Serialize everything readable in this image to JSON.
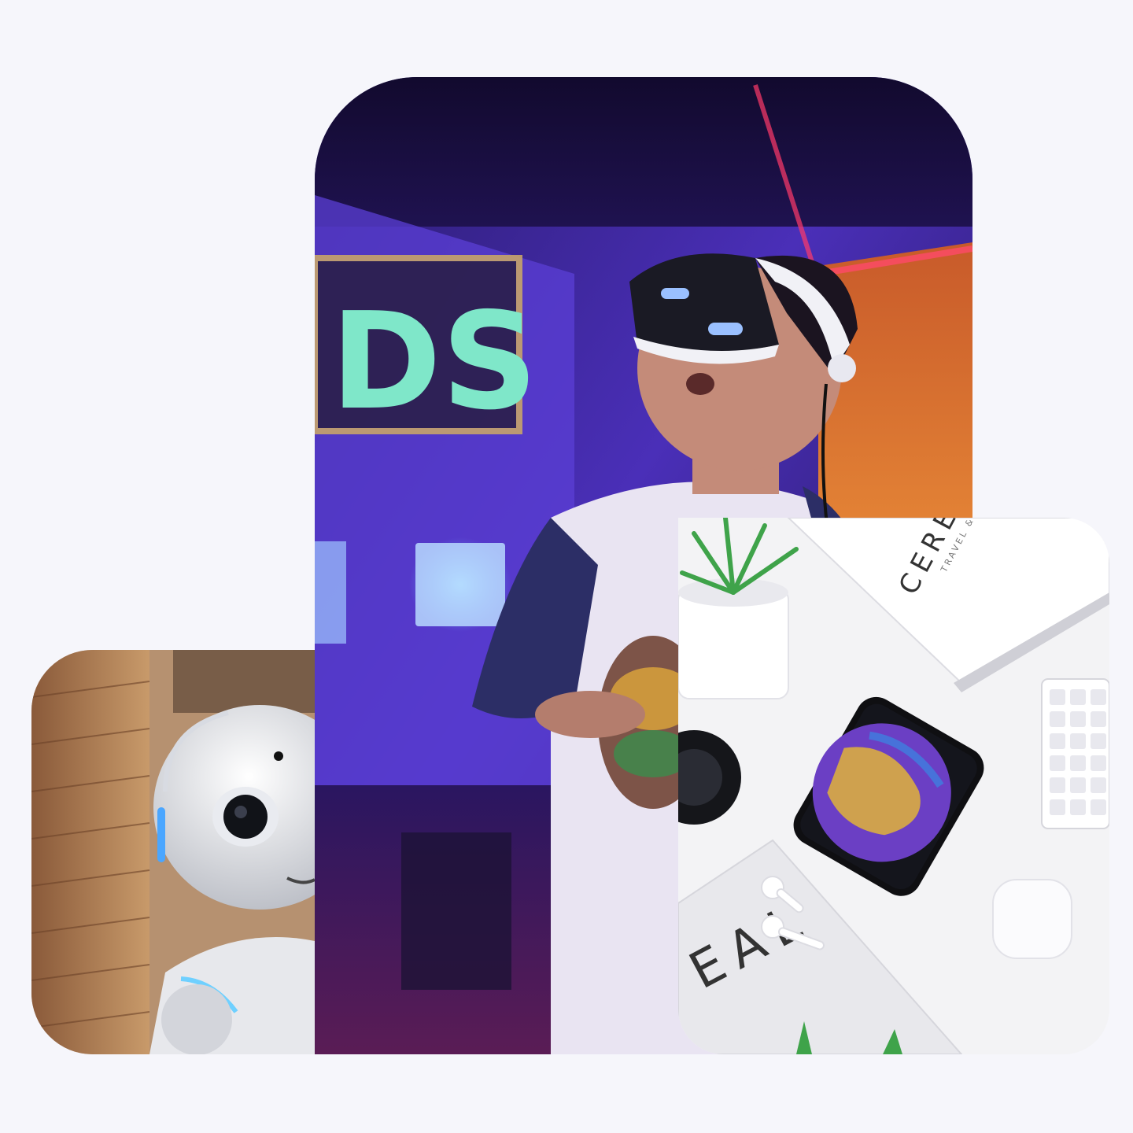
{
  "gallery": {
    "images": [
      {
        "id": "vr",
        "icon": "vr-headset-person-photo"
      },
      {
        "id": "robot",
        "icon": "humanoid-robot-photo"
      },
      {
        "id": "desk",
        "icon": "desk-flatlay-photo"
      }
    ],
    "magazine_title": "CEREAL",
    "magazine_subtitle": "TRAVEL & STYLE",
    "magazine_cover_text": "EAL",
    "sign_text": "DS"
  },
  "colors": {
    "page_background": "#f6f6fb",
    "neon_purple": "#6f3df0",
    "neon_blue": "#7fa8ff",
    "warm_orange": "#f39a3c"
  }
}
